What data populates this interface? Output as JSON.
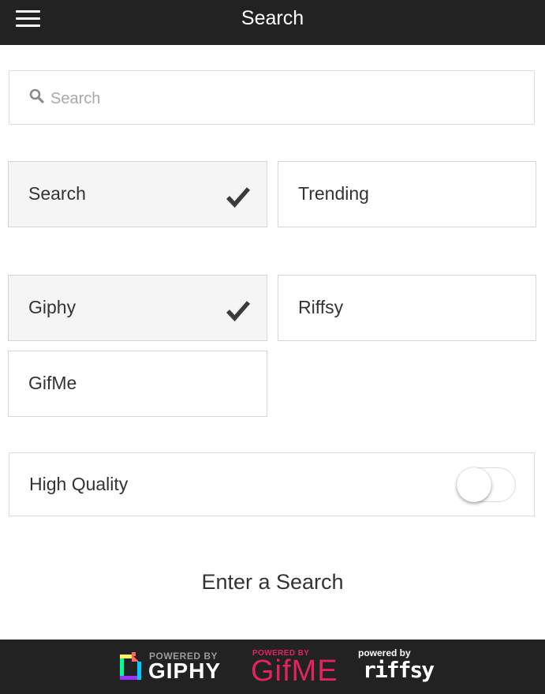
{
  "header": {
    "title": "Search",
    "menu_icon": "hamburger-menu-icon"
  },
  "search": {
    "placeholder": "Search",
    "value": "",
    "icon": "search-icon"
  },
  "mode_options": [
    {
      "label": "Search",
      "selected": true
    },
    {
      "label": "Trending",
      "selected": false
    }
  ],
  "source_options": [
    {
      "label": "Giphy",
      "selected": true
    },
    {
      "label": "Riffsy",
      "selected": false
    },
    {
      "label": "GifMe",
      "selected": false
    }
  ],
  "settings": {
    "high_quality_label": "High Quality",
    "high_quality_enabled": false
  },
  "results": {
    "empty_message": "Enter a Search"
  },
  "footer": {
    "giphy": {
      "powered": "POWERED BY",
      "name": "GIPHY"
    },
    "gifme": {
      "powered": "POWERED BY",
      "name": "GifME",
      "color": "#e0245e"
    },
    "riffsy": {
      "powered": "powered by",
      "name": "riffsy"
    }
  },
  "colors": {
    "header_bg": "#222222",
    "selected_tile_bg": "#f5f5f5",
    "border": "#d6d6d6"
  }
}
